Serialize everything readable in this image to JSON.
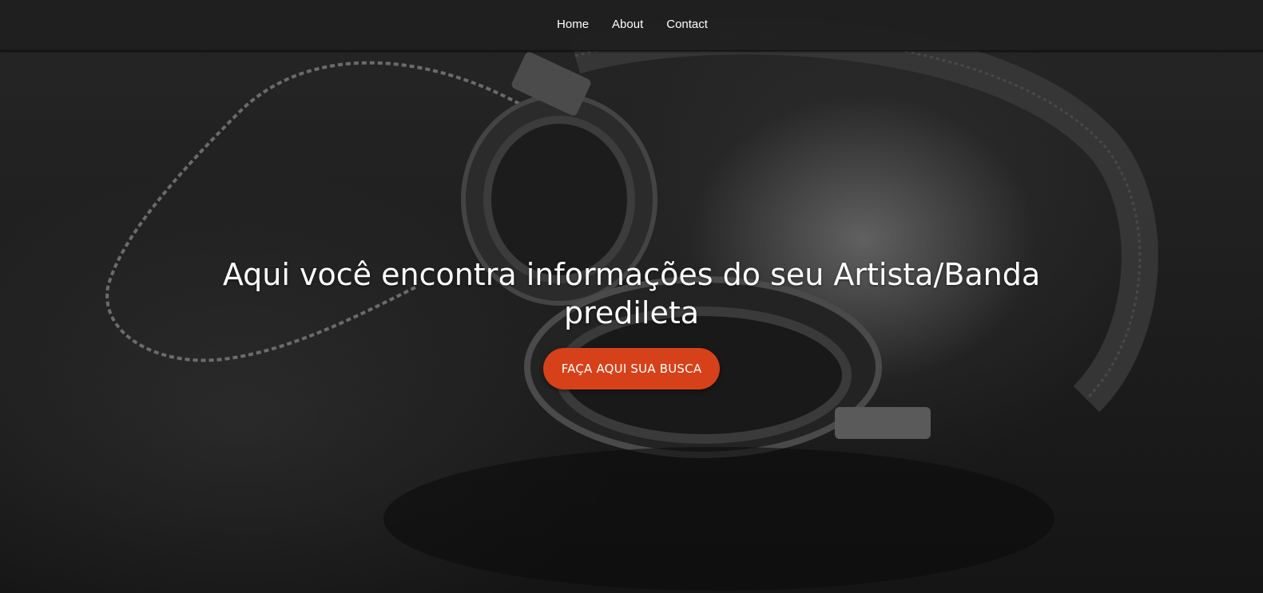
{
  "nav": {
    "items": [
      {
        "label": "Home"
      },
      {
        "label": "About"
      },
      {
        "label": "Contact"
      }
    ]
  },
  "hero": {
    "title": "Aqui você encontra informações do seu Artista/Banda predileta",
    "cta_label": "FAÇA AQUI SUA BUSCA",
    "background_image": "headphones-photo",
    "colors": {
      "accent": "#d6411a",
      "navbar": "#1e1e1e",
      "text": "#ffffff"
    }
  }
}
